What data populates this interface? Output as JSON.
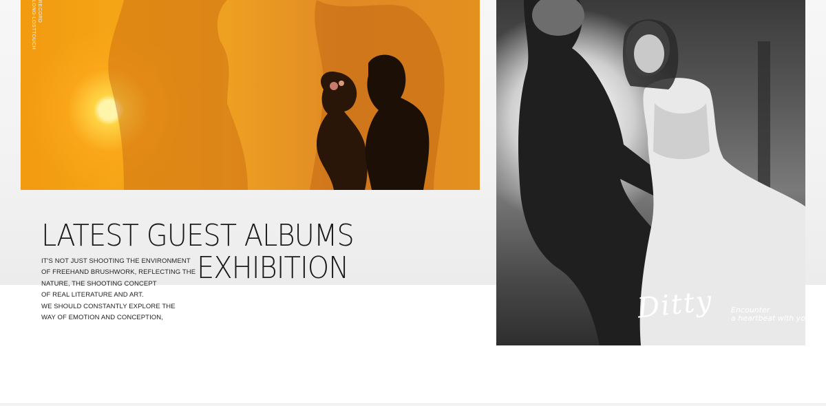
{
  "section": {
    "title_line1": "LATEST GUEST ALBUMS",
    "title_line2": "EXHIBITION",
    "description": [
      "IT'S NOT JUST SHOOTING THE ENVIRONMENT",
      " OF FREEHAND BRUSHWORK, REFLECTING THE",
      "NATURE, THE SHOOTING CONCEPT",
      " OF REAL LITERATURE AND ART.",
      "WE SHOULD CONSTANTLY EXPLORE THE",
      " WAY OF EMOTION AND CONCEPTION,"
    ]
  },
  "photo_left": {
    "vertical_text": [
      "RECORD",
      "LONG-LOSTTOUCH"
    ]
  },
  "photo_right": {
    "signature": "Ditty",
    "tagline": [
      "Encounter",
      "a heartbeat with you"
    ]
  },
  "colors": {
    "sunset": "#f39a10",
    "band": "#f3f3f3",
    "text": "#1a1a1a"
  }
}
